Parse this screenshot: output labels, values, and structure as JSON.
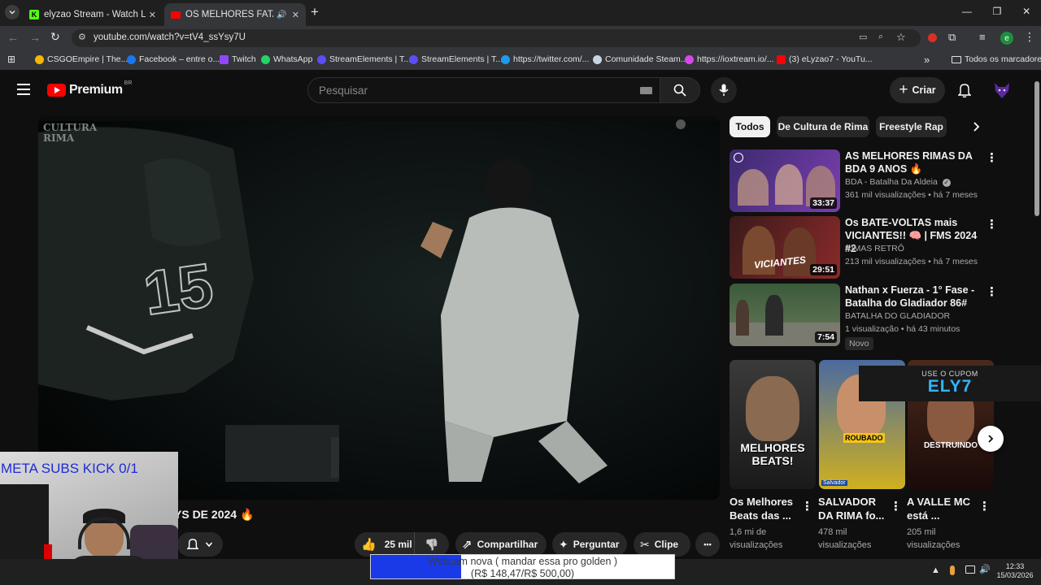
{
  "browser": {
    "tabs": [
      {
        "title": "elyzao Stream - Watch Live on",
        "close": "✕"
      },
      {
        "title": "OS MELHORES FATALITYS D",
        "close": "✕"
      }
    ],
    "new_tab": "+",
    "url": "youtube.com/watch?v=tV4_ssYsy7U",
    "profile_initial": "e",
    "bookmarks": [
      {
        "label": "CSGOEmpire | The...",
        "color": "#f5b800"
      },
      {
        "label": "Facebook – entre o...",
        "color": "#1877f2"
      },
      {
        "label": "Twitch",
        "color": "#9146ff"
      },
      {
        "label": "WhatsApp",
        "color": "#25d366"
      },
      {
        "label": "StreamElements | T...",
        "color": "#5c4df5"
      },
      {
        "label": "StreamElements | T...",
        "color": "#5c4df5"
      },
      {
        "label": "https://twitter.com/...",
        "color": "#1d9bf0"
      },
      {
        "label": "Comunidade Steam...",
        "color": "#c7d5e0"
      },
      {
        "label": "https://ioxtream.io/...",
        "color": "#d946ef"
      },
      {
        "label": "(3) eLyzao7 - YouTu...",
        "color": "#ff0000"
      }
    ],
    "bookmarks_overflow": "»",
    "all_bookmarks": "Todos os marcadores"
  },
  "youtube": {
    "logo_text": "Premium",
    "logo_region": "BR",
    "search_placeholder": "Pesquisar",
    "create_label": "Criar",
    "chips": [
      "Todos",
      "De Cultura de Rima",
      "Freestyle Rap"
    ],
    "video_title_partial": "YS DE 2024 🔥",
    "video_watermark": "CULTURA\nRIMA",
    "jersey_number": "15",
    "actions": {
      "likes": "25 mil",
      "share": "Compartilhar",
      "ask": "Perguntar",
      "clip": "Clipe",
      "more": "•••"
    },
    "related": [
      {
        "title": "AS MELHORES RIMAS DA BDA 9 ANOS 🔥",
        "channel": "BDA - Batalha Da Aldeia",
        "verified": true,
        "meta": "361 mil visualizações • há 7 meses",
        "duration": "33:37",
        "colors": [
          "#3b2a6e",
          "#7a3fb0"
        ]
      },
      {
        "title": "Os BATE-VOLTAS mais VICIANTES!! 🧠 | FMS 2024 #2",
        "channel": "RIMAS RETRÔ",
        "verified": false,
        "meta": "213 mil visualizações • há 7 meses",
        "duration": "29:51",
        "colors": [
          "#3a1a1a",
          "#8a2a2a"
        ]
      },
      {
        "title": "Nathan x Fuerza - 1° Fase - Batalha do Gladiador 86#",
        "channel": "BATALHA DO GLADIADOR",
        "verified": false,
        "meta": "1 visualização • há 43 minutos",
        "duration": "7:54",
        "badge": "Novo",
        "colors": [
          "#2f4a2a",
          "#6a8a4a"
        ]
      }
    ],
    "shorts": [
      {
        "title": "Os Melhores Beats das ...",
        "views": "1,6 mi de visualizações",
        "overlay": "MELHORES BEATS!",
        "colors": [
          "#3a3a3a",
          "#1a1a1a"
        ]
      },
      {
        "title": "SALVADOR DA RIMA fo...",
        "views": "478 mil visualizações",
        "overlay": "ROUBADO",
        "tag": "Salvador",
        "colors": [
          "#4a6aa0",
          "#d0b020"
        ]
      },
      {
        "title": "A VALLE MC está ...",
        "views": "205 mil visualizações",
        "overlay": "DESTRUINDO",
        "colors": [
          "#4a2a1a",
          "#1a0a0a"
        ]
      }
    ]
  },
  "stream_overlay": {
    "goal_text": "META SUBS KICK 0/1",
    "coupon_label": "USE O CUPOM",
    "coupon_code": "ELY7",
    "donation_title": "Webcam nova ( mandar essa pro golden )",
    "donation_progress": "(R$ 148,47/R$ 500,00)",
    "donation_fraction": 0.297
  },
  "taskbar": {
    "time": "12:33",
    "date": "15/03/2026"
  }
}
